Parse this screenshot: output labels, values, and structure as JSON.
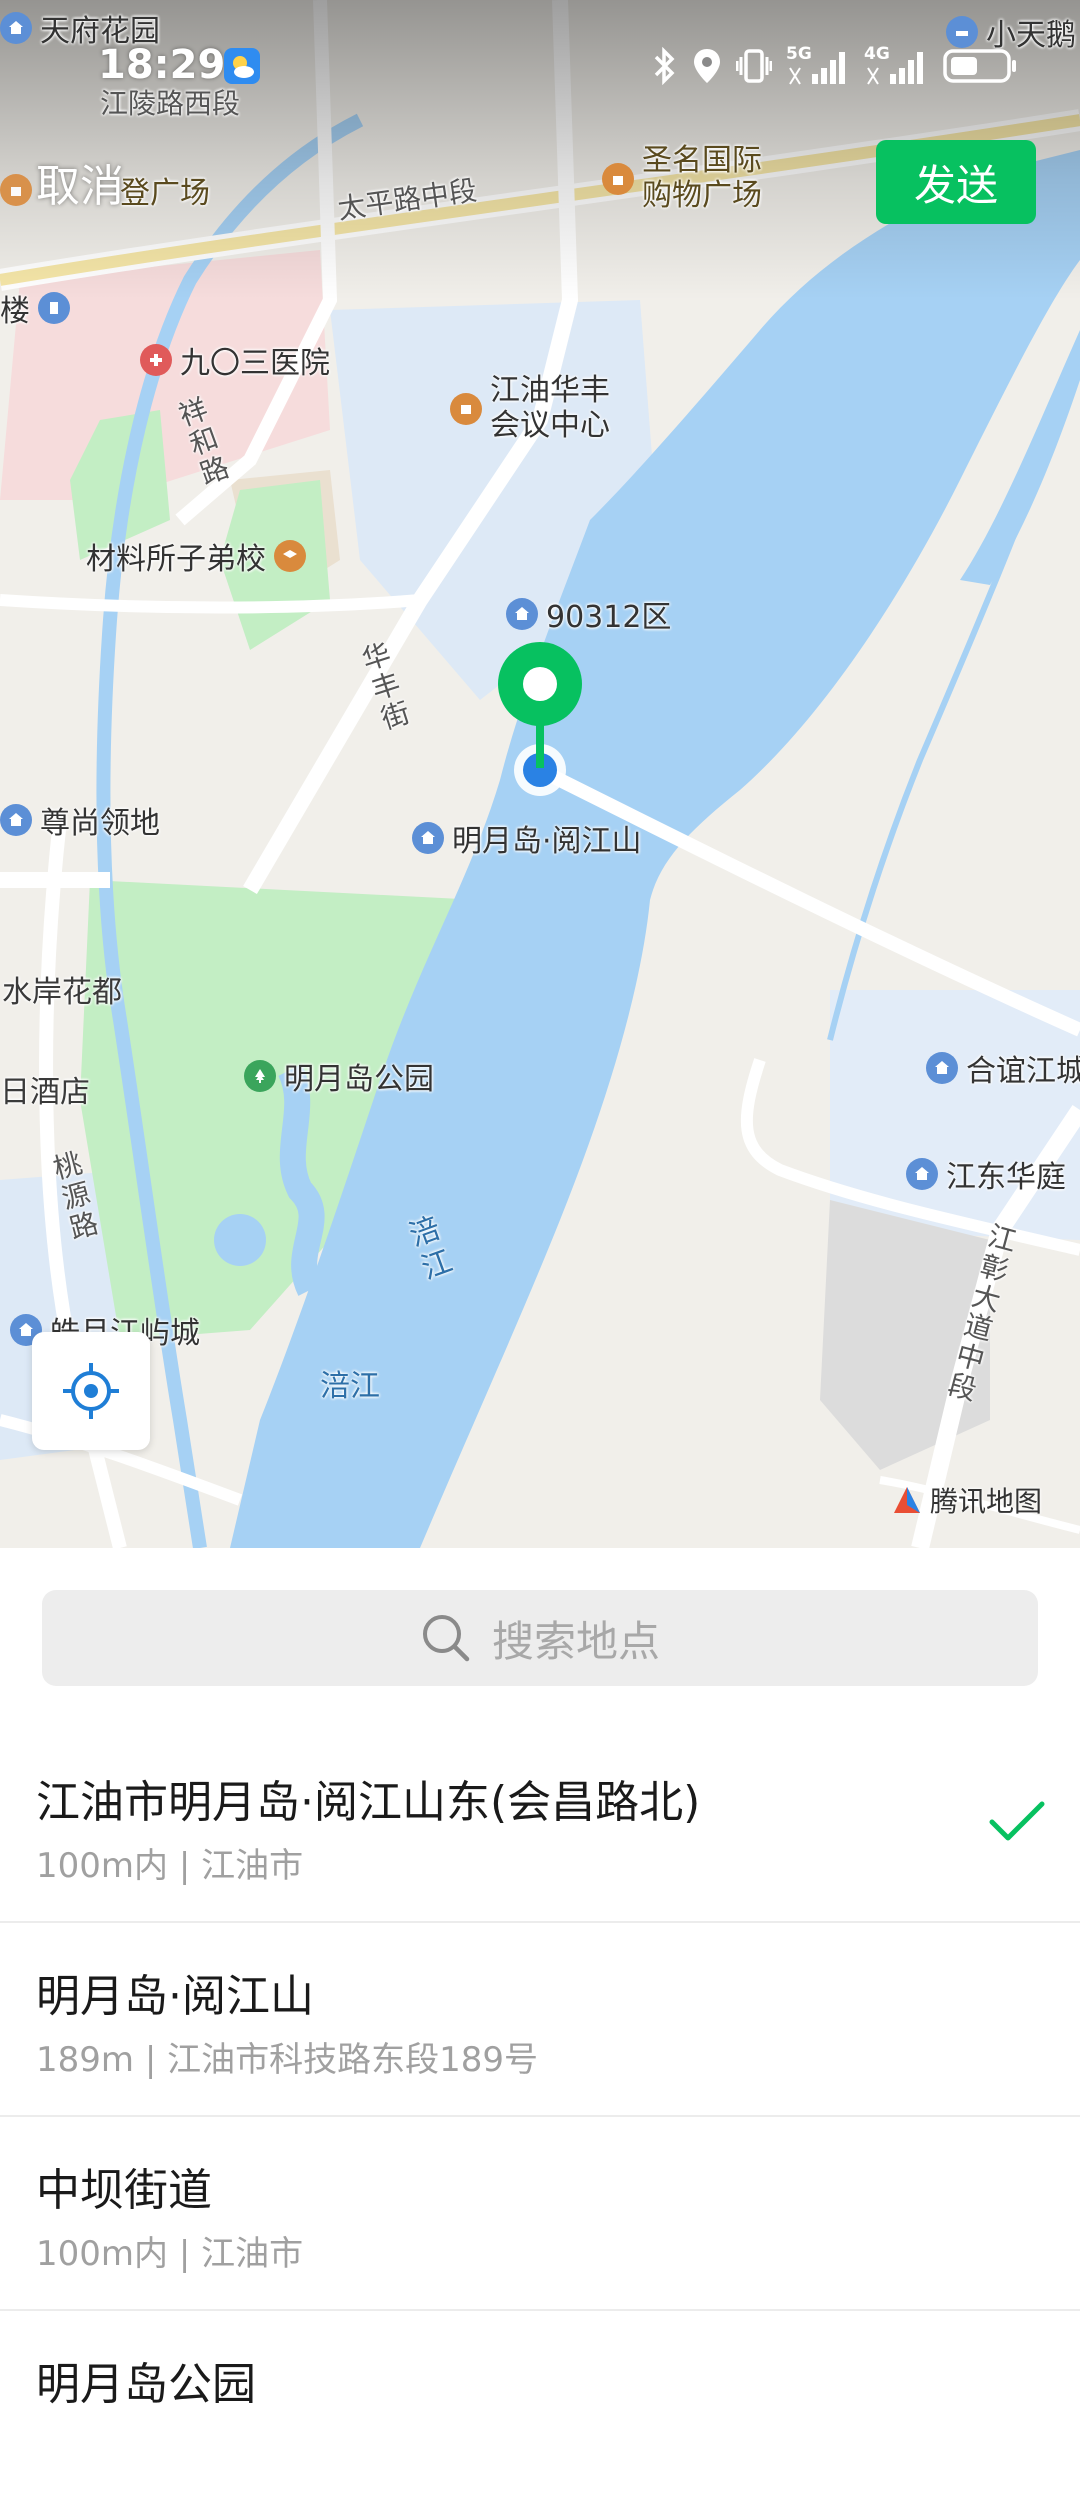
{
  "status_bar": {
    "time": "18:29",
    "network_5g": "5G",
    "network_4g": "4G"
  },
  "header": {
    "cancel_label": "取消",
    "send_label": "发送",
    "send_color": "#07c160"
  },
  "map": {
    "labels": {
      "tianfu": "天府花园",
      "xiaotian": "小天鹅",
      "jianglinglu": "江陵路西段",
      "deng_guangchang": "登广场",
      "shengming_1": "圣名国际",
      "shengming_2": "购物广场",
      "taipinglu": "太平路中段",
      "lou": "楼",
      "hospital": "九〇三医院",
      "huafeng_1": "江油华丰",
      "huafeng_2": "会议中心",
      "xianghe_lu": "祥和路",
      "cailiao": "材料所子弟校",
      "district_90312": "90312区",
      "huafeng_jie": "华丰街",
      "zunshang": "尊尚领地",
      "mingyuedao_yuejiangshan": "明月岛·阅江山",
      "shuian": "水岸花都",
      "park": "明月岛公园",
      "jiudian": "日酒店",
      "taoyuan_lu": "桃源路",
      "peijiang_vertical": "涪江",
      "peijiang": "涪江",
      "haoyue": "皓月江屿城",
      "heyi": "合谊江城",
      "jiangdong": "江东华庭",
      "jiangzhang": "江彰大道中段",
      "tencent_map": "腾讯地图"
    }
  },
  "search": {
    "placeholder": "搜索地点"
  },
  "results": [
    {
      "title": "江油市明月岛·阅江山东(会昌路北)",
      "subtitle": "100m内 | 江油市",
      "selected": true
    },
    {
      "title": "明月岛·阅江山",
      "subtitle": "189m | 江油市科技路东段189号",
      "selected": false
    },
    {
      "title": "中坝街道",
      "subtitle": "100m内 | 江油市",
      "selected": false
    },
    {
      "title": "明月岛公园",
      "subtitle": "",
      "selected": false
    }
  ]
}
